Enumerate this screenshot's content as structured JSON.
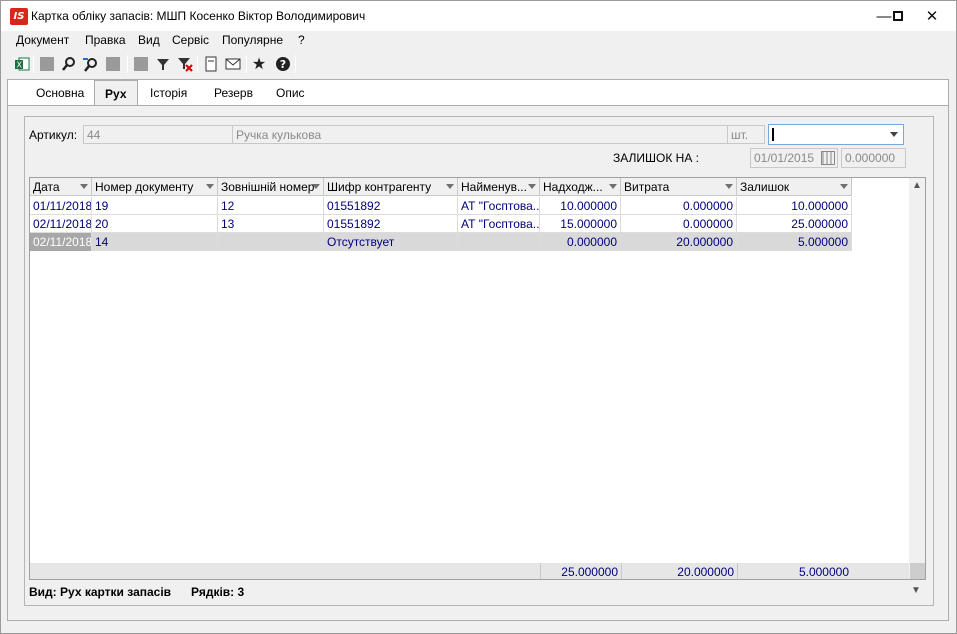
{
  "window": {
    "logo": "IS",
    "title": "Картка обліку запасів: МШП Косенко Віктор Володимирович",
    "minimize": "—",
    "maximize": "☐",
    "close": "✕"
  },
  "menu": [
    "Документ",
    "Правка",
    "Вид",
    "Сервіс",
    "Популярне",
    "?"
  ],
  "toolbar": {
    "icons": [
      "excel-icon",
      "square-icon",
      "search-icon",
      "find-next-icon",
      "square-icon",
      "square-icon",
      "filter-icon",
      "clear-filter-icon",
      "document-icon",
      "mail-icon",
      "star-icon",
      "help-icon"
    ]
  },
  "tabs": [
    "Основна",
    "Рух",
    "Історія",
    "Резерв",
    "Опис"
  ],
  "active_tab": "Рух",
  "article": {
    "label": "Артикул:",
    "code": "44",
    "name": "Ручка кулькова",
    "unit": "шт.",
    "combo_value": ""
  },
  "balance": {
    "label": "ЗАЛИШОК НА :",
    "date": "01/01/2015",
    "value": "0.000000"
  },
  "grid": {
    "columns": [
      "Дата",
      "Номер документу",
      "Зовнішній номер",
      "Шифр контрагенту",
      "Найменув...",
      "Надходж...",
      "Витрата",
      "Залишок"
    ],
    "rows": [
      [
        "01/11/2018",
        "19",
        "12",
        "01551892",
        "АТ \"Госптова...",
        "10.000000",
        "0.000000",
        "10.000000"
      ],
      [
        "02/11/2018",
        "20",
        "13",
        "01551892",
        "АТ \"Госптова...",
        "15.000000",
        "0.000000",
        "25.000000"
      ],
      [
        "02/11/2018",
        "14",
        "",
        "Отсутствует",
        "",
        "0.000000",
        "20.000000",
        "5.000000"
      ]
    ],
    "totals": [
      "25.000000",
      "20.000000",
      "5.000000"
    ]
  },
  "status": {
    "view": "Вид: Рух картки запасів",
    "rows": "Рядків: 3"
  }
}
